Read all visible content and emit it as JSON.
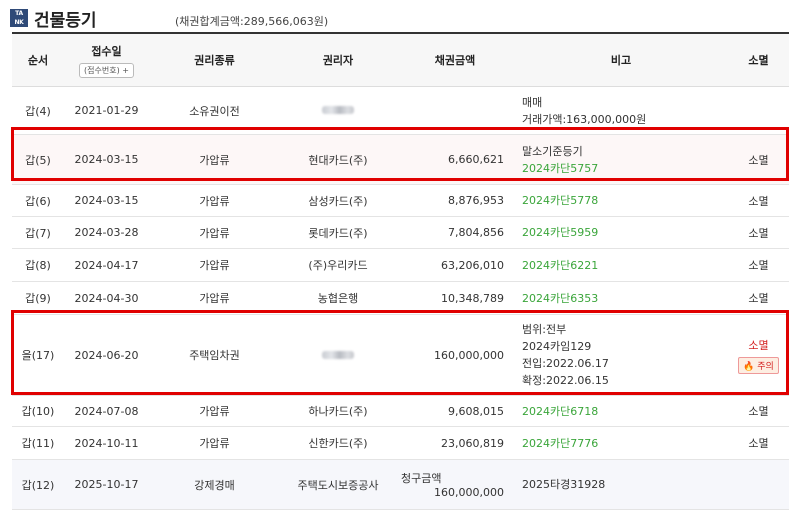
{
  "header": {
    "logo_top": "TA",
    "logo_bottom": "NK",
    "title": "건물등기",
    "total_label": "(채권합계금액:289,566,063원)"
  },
  "columns": {
    "order": "순서",
    "date": "접수일",
    "date_sub": "(접수번호) +",
    "type": "권리종류",
    "holder": "권리자",
    "amount": "채권금액",
    "note": "비고",
    "extinct": "소멸"
  },
  "rows": [
    {
      "order": "갑(4)",
      "date": "2021-01-29",
      "type": "소유권이전",
      "holder": "",
      "amount": "",
      "note": [
        "매매",
        "거래가액:163,000,000원"
      ],
      "extinct": ""
    },
    {
      "order": "갑(5)",
      "date": "2024-03-15",
      "type": "가압류",
      "holder": "현대카드(주)",
      "amount": "6,660,621",
      "note": [
        "말소기준등기"
      ],
      "case": "2024카단5757",
      "extinct": "소멸"
    },
    {
      "order": "갑(6)",
      "date": "2024-03-15",
      "type": "가압류",
      "holder": "삼성카드(주)",
      "amount": "8,876,953",
      "case": "2024카단5778",
      "extinct": "소멸"
    },
    {
      "order": "갑(7)",
      "date": "2024-03-28",
      "type": "가압류",
      "holder": "롯데카드(주)",
      "amount": "7,804,856",
      "case": "2024카단5959",
      "extinct": "소멸"
    },
    {
      "order": "갑(8)",
      "date": "2024-04-17",
      "type": "가압류",
      "holder": "(주)우리카드",
      "amount": "63,206,010",
      "case": "2024카단6221",
      "extinct": "소멸"
    },
    {
      "order": "갑(9)",
      "date": "2024-04-30",
      "type": "가압류",
      "holder": "농협은행",
      "amount": "10,348,789",
      "case": "2024카단6353",
      "extinct": "소멸"
    },
    {
      "order": "을(17)",
      "date": "2024-06-20",
      "type": "주택임차권",
      "holder": "",
      "amount": "160,000,000",
      "note": [
        "범위:전부",
        "2024카임129",
        "전입:2022.06.17",
        "확정:2022.06.15"
      ],
      "extinct": "소멸",
      "badge": "주의"
    },
    {
      "order": "갑(10)",
      "date": "2024-07-08",
      "type": "가압류",
      "holder": "하나카드(주)",
      "amount": "9,608,015",
      "case": "2024카단6718",
      "extinct": "소멸"
    },
    {
      "order": "갑(11)",
      "date": "2024-10-11",
      "type": "가압류",
      "holder": "신한카드(주)",
      "amount": "23,060,819",
      "case": "2024카단7776",
      "extinct": "소멸"
    },
    {
      "order": "갑(12)",
      "date": "2025-10-17",
      "type": "강제경매",
      "holder": "주택도시보증공사",
      "amount_label": "청구금액",
      "amount": "160,000,000",
      "note": [
        "2025타경31928"
      ],
      "extinct": ""
    }
  ]
}
